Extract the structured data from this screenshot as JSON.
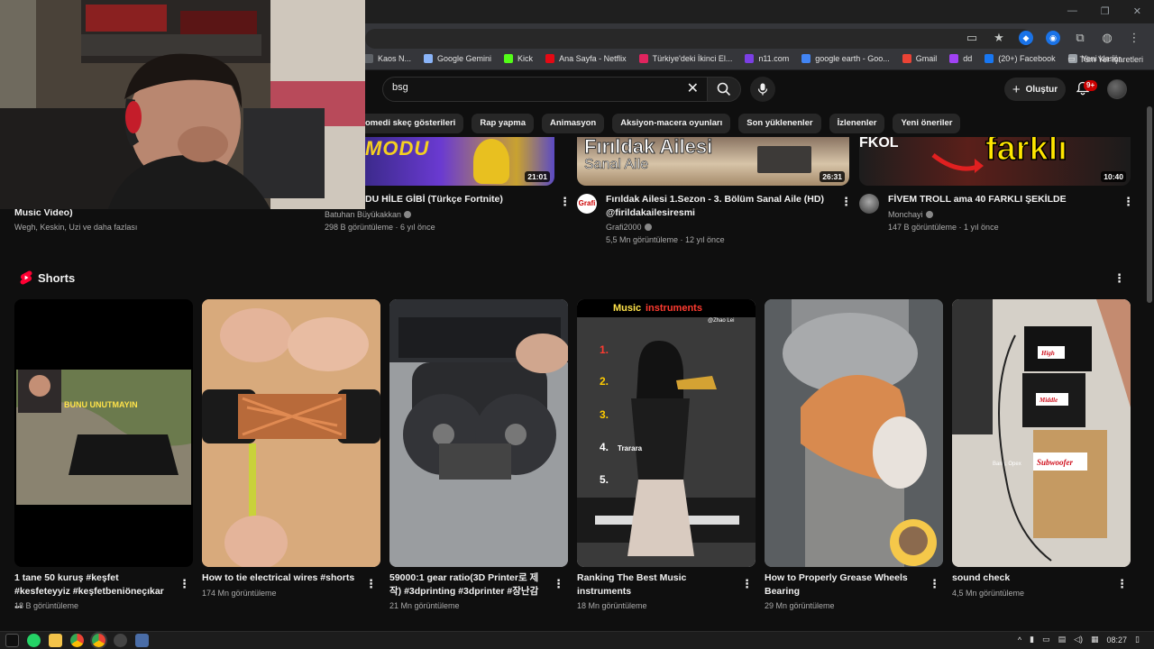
{
  "browser": {
    "bookmarks": [
      {
        "label": "Kaos N...",
        "color": "#5f6368"
      },
      {
        "label": "Google Gemini",
        "color": "#8ab4f8"
      },
      {
        "label": "Kick",
        "color": "#53fc18"
      },
      {
        "label": "Ana Sayfa - Netflix",
        "color": "#e50914"
      },
      {
        "label": "Türkiye'deki İkinci El...",
        "color": "#e0245e"
      },
      {
        "label": "n11.com",
        "color": "#7b3fe4"
      },
      {
        "label": "google earth - Goo...",
        "color": "#4285f4"
      },
      {
        "label": "Gmail",
        "color": "#ea4335"
      },
      {
        "label": "dd",
        "color": "#a142f4"
      },
      {
        "label": "(20+) Facebook",
        "color": "#1877f2"
      },
      {
        "label": "Yeni klasör",
        "color": "#9aa0a6"
      }
    ],
    "all_bookmarks": "Tüm Yer İşaretleri"
  },
  "header": {
    "search_value": "bsg",
    "create_label": "Oluştur",
    "notif_badge": "9+"
  },
  "chips": [
    "omedi skeç gösterileri",
    "Rap yapma",
    "Animasyon",
    "Aksiyon-macera oyunları",
    "Son yüklenenler",
    "İzlenenler",
    "Yeni öneriler"
  ],
  "top_videos": [
    {
      "title": "Music Video)",
      "channel": "Wegh, Keskin, Uzi ve daha fazlası"
    },
    {
      "title": "RÜ MODU HİLE GİBİ (Türkçe Fortnite)",
      "channel": "Batuhan Büyükakkan",
      "stats": "298 B görüntüleme · 6 yıl önce",
      "duration": "21:01"
    },
    {
      "title": "Fırıldak Ailesi 1.Sezon - 3. Bölüm Sanal Aile (HD) @firildakailesiresmi",
      "channel": "Grafi2000",
      "stats": "5,5 Mn görüntüleme · 12 yıl önce",
      "duration": "26:31",
      "thumb_text1": "Fırıldak Ailesi",
      "thumb_text2": "Sanal Aile",
      "avatar_text": "Grafi"
    },
    {
      "title": "FİVEM TROLL ama 40 FARKLI ŞEKİLDE",
      "channel": "Monchayi",
      "stats": "147 B görüntüleme · 1 yıl önce",
      "duration": "10:40",
      "thumb_text": "farklı"
    }
  ],
  "shorts": {
    "heading": "Shorts",
    "items": [
      {
        "title": "1 tane 50 kuruş #keşfet #kesfeteyyiz #keşfetbeniöneçıkar ...",
        "views": "18 B görüntüleme",
        "thumb_text": "BUNU UNUTMAYIN"
      },
      {
        "title": "How to tie electrical wires #shorts",
        "views": "174 Mn görüntüleme"
      },
      {
        "title": "59000:1 gear ratio(3D Printer로 제작) #3dprinting #3dprinter #장난감",
        "views": "21 Mn görüntüleme"
      },
      {
        "title": "Ranking The Best Music instruments",
        "views": "18 Mn görüntüleme",
        "thumb_word1": "Music",
        "thumb_word2": "instruments",
        "thumb_credit": "@Zhao Lei",
        "thumb_label": "Trarara"
      },
      {
        "title": "How to Properly Grease Wheels Bearing",
        "views": "29 Mn görüntüleme"
      },
      {
        "title": "sound check",
        "views": "4,5 Mn görüntüleme",
        "label_high": "High",
        "label_middle": "Middle",
        "label_sub": "Subwoofer",
        "label_bang": "Bang, Opex"
      }
    ]
  },
  "taskbar": {
    "clock": "08:27"
  }
}
